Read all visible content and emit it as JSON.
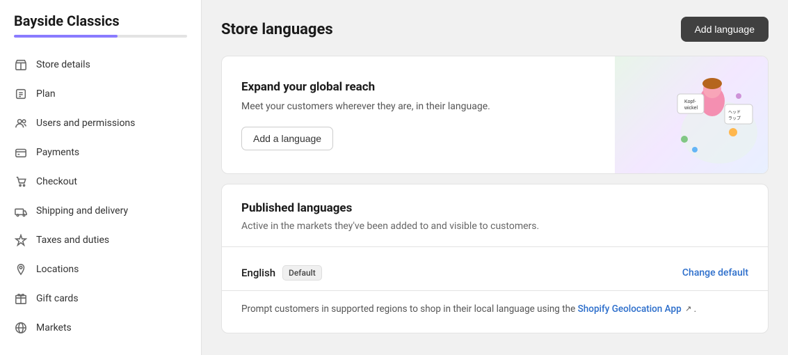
{
  "sidebar": {
    "store_name": "Bayside Classics",
    "items": [
      {
        "id": "store-details",
        "label": "Store details",
        "icon": "store"
      },
      {
        "id": "plan",
        "label": "Plan",
        "icon": "plan"
      },
      {
        "id": "users-and-permissions",
        "label": "Users and permissions",
        "icon": "users"
      },
      {
        "id": "payments",
        "label": "Payments",
        "icon": "payments"
      },
      {
        "id": "checkout",
        "label": "Checkout",
        "icon": "checkout"
      },
      {
        "id": "shipping-and-delivery",
        "label": "Shipping and delivery",
        "icon": "shipping"
      },
      {
        "id": "taxes-and-duties",
        "label": "Taxes and duties",
        "icon": "taxes"
      },
      {
        "id": "locations",
        "label": "Locations",
        "icon": "locations"
      },
      {
        "id": "gift-cards",
        "label": "Gift cards",
        "icon": "gift"
      },
      {
        "id": "markets",
        "label": "Markets",
        "icon": "markets"
      }
    ]
  },
  "header": {
    "page_title": "Store languages",
    "add_language_button": "Add language"
  },
  "expand_card": {
    "title": "Expand your global reach",
    "description": "Meet your customers wherever they are, in their language.",
    "button_label": "Add a language"
  },
  "published_card": {
    "title": "Published languages",
    "description": "Active in the markets they've been added to and visible to customers.",
    "language": "English",
    "badge": "Default",
    "change_default_link": "Change default",
    "geolocation_text": "Prompt customers in supported regions to shop in their local language using the",
    "geolocation_link": "Shopify Geolocation App",
    "geolocation_suffix": "."
  }
}
